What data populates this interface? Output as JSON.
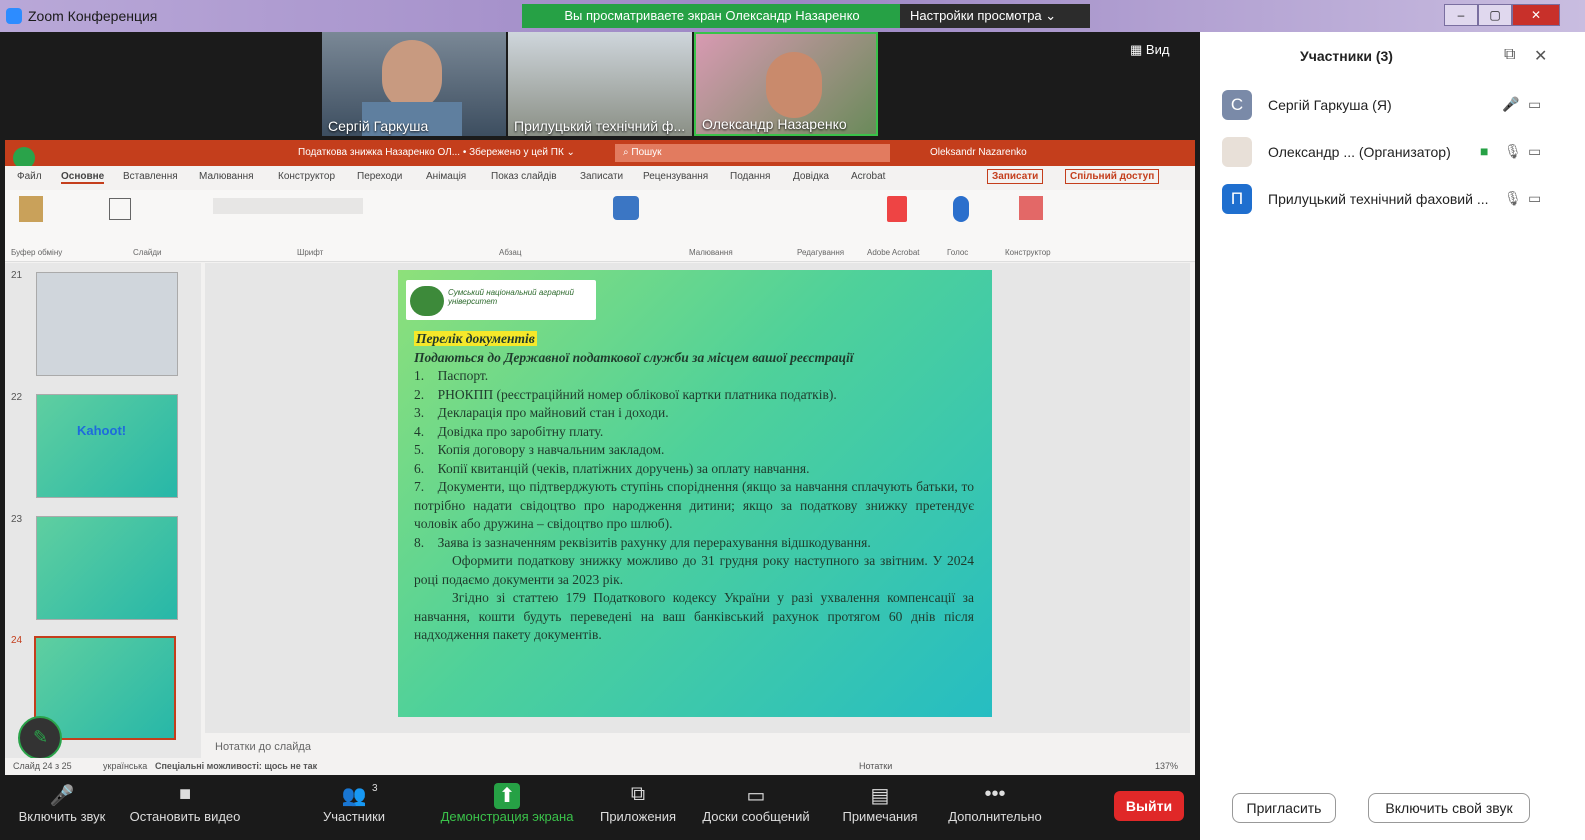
{
  "window": {
    "title": "Zoom Конференция",
    "share_banner": "Вы просматриваете экран Олександр Назаренко",
    "view_options": "Настройки просмотра ⌄",
    "view_label": "Вид"
  },
  "videos": [
    {
      "name": "Сергій Гаркуша"
    },
    {
      "name": "Прилуцький технічний ф..."
    },
    {
      "name": "Олександр Назаренко"
    }
  ],
  "ppt": {
    "title_center": "Податкова знижка Назаренко ОЛ... • Збережено у цей ПК ⌄",
    "search": "Пошук",
    "user": "Oleksandr Nazarenko",
    "tabs": [
      "Файл",
      "Основне",
      "Вставлення",
      "Малювання",
      "Конструктор",
      "Переходи",
      "Анімація",
      "Показ слайдів",
      "Записати",
      "Рецензування",
      "Подання",
      "Довідка",
      "Acrobat"
    ],
    "record_btn": "Записати",
    "share_btn": "Спільний доступ",
    "groups": [
      "Буфер обміну",
      "Слайди",
      "Шрифт",
      "Абзац",
      "Малювання",
      "Редагування",
      "Adobe Acrobat",
      "Голос",
      "Конструктор"
    ],
    "thumb_numbers": [
      "21",
      "22",
      "23",
      "24"
    ],
    "thumb_kahoot": "Kahoot!",
    "notes": "Нотатки до слайда",
    "status_left": "Слайд 24 з 25",
    "status_lang": "українська",
    "status_access": "Спеціальні можливості: щось не так",
    "status_notes": "Нотатки",
    "zoom": "137%"
  },
  "slide": {
    "logo": "Сумський національний аграрний університет",
    "heading": "Перелік документів",
    "subheading": "Подаються до Державної податкової служби за місцем вашої реєстрації",
    "items": [
      "1. Паспорт.",
      "2. РНОКПП (реєстраційний номер облікової картки платника податків).",
      "3. Декларація про майновий стан і доходи.",
      "4. Довідка про заробітну плату.",
      "5. Копія договору з навчальним закладом.",
      "6. Копії квитанцій (чеків, платіжних доручень) за оплату навчання.",
      "7. Документи, що підтверджують ступінь споріднення (якщо за навчання сплачують батьки, то потрібно надати свідоцтво про народження дитини; якщо за податкову знижку претендує чоловік або дружина – свідоцтво про шлюб).",
      "8. Заява із зазначенням реквізитів рахунку для перерахування відшкодування."
    ],
    "para1": "Оформити податкову знижку можливо до 31 грудня року наступного за звітним. У 2024 році подаємо документи за 2023 рік.",
    "para2": "Згідно зі статтею 179 Податкового кодексу України у разі ухвалення компенсації за навчання, кошти будуть переведені на ваш банківський рахунок протягом 60 днів після надходження пакету документів."
  },
  "toolbar": [
    {
      "label": "Включить звук",
      "icon": "🎤"
    },
    {
      "label": "Остановить видео",
      "icon": "■"
    },
    {
      "label": "Участники",
      "icon": "👥",
      "count": "3"
    },
    {
      "label": "Демонстрация экрана",
      "icon": "⬆"
    },
    {
      "label": "Приложения",
      "icon": "⧉"
    },
    {
      "label": "Доски сообщений",
      "icon": "▭"
    },
    {
      "label": "Примечания",
      "icon": "▤"
    },
    {
      "label": "Дополнительно",
      "icon": "•••"
    }
  ],
  "leave": "Выйти",
  "panel": {
    "title": "Участники (3)",
    "participants": [
      {
        "initial": "С",
        "name": "Сергій Гаркуша (Я)",
        "color": "#7a8aa8"
      },
      {
        "initial": "",
        "name": "Олександр ... (Организатор)",
        "color": "#e8e0d8"
      },
      {
        "initial": "П",
        "name": "Прилуцький технічний фаховий ...",
        "color": "#1f6fcf"
      }
    ],
    "invite": "Пригласить",
    "unmute": "Включить свой звук"
  }
}
